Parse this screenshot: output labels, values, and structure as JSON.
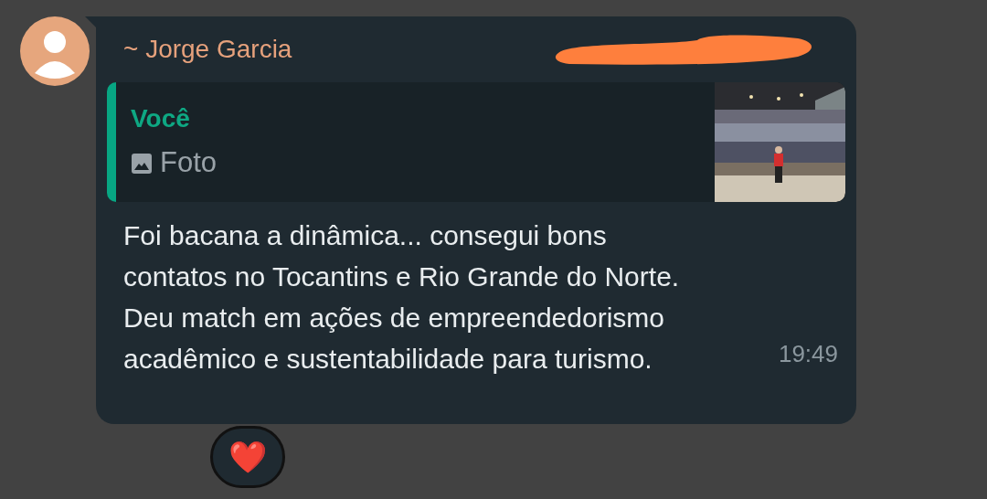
{
  "message": {
    "sender": "~ Jorge Garcia",
    "quote": {
      "author": "Você",
      "label": "Foto"
    },
    "text": "Foi bacana a dinâmica... consegui bons contatos no Tocantins e Rio Grande do Norte. Deu match em ações de empreendedorismo acadêmico e sustentabilidade para turismo.",
    "time": "19:49",
    "reaction": "❤️"
  }
}
